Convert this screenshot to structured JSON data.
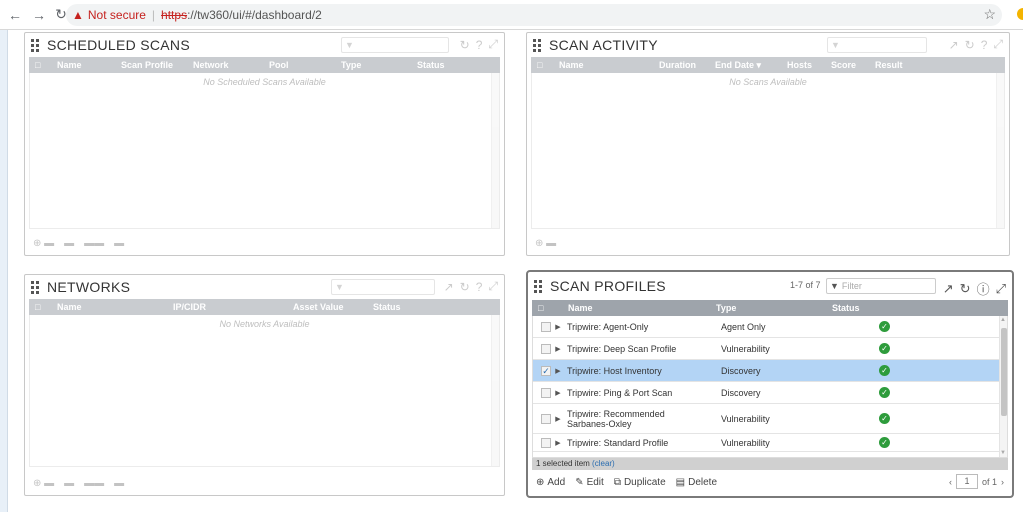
{
  "browser": {
    "not_secure": "Not secure",
    "url_https": "https",
    "url_rest": "://tw360/ui/#/dashboard/2"
  },
  "scheduled_scans": {
    "title": "SCHEDULED SCANS",
    "columns": [
      "Name",
      "Scan Profile",
      "Network",
      "Pool",
      "Type",
      "Status"
    ],
    "empty": "No Scheduled Scans Available"
  },
  "scan_activity": {
    "title": "SCAN ACTIVITY",
    "columns": [
      "Name",
      "Duration",
      "End Date ▾",
      "Hosts",
      "Score",
      "Result"
    ],
    "empty": "No Scans Available"
  },
  "networks": {
    "title": "NETWORKS",
    "columns": [
      "Name",
      "IP/CIDR",
      "Asset Value",
      "Status"
    ],
    "empty": "No Networks Available"
  },
  "scan_profiles": {
    "title": "SCAN PROFILES",
    "count": "1-7 of 7",
    "filter_placeholder": "Filter",
    "columns": [
      "Name",
      "Type",
      "Status"
    ],
    "rows": [
      {
        "name": "Tripwire: Agent-Only",
        "type": "Agent Only"
      },
      {
        "name": "Tripwire: Deep Scan Profile",
        "type": "Vulnerability"
      },
      {
        "name": "Tripwire: Host Inventory",
        "type": "Discovery"
      },
      {
        "name": "Tripwire: Ping & Port Scan",
        "type": "Discovery"
      },
      {
        "name": "Tripwire: Recommended Sarbanes-Oxley",
        "type": "Vulnerability"
      },
      {
        "name": "Tripwire: Standard Profile",
        "type": "Vulnerability"
      }
    ],
    "selected_text": "1 selected item",
    "clear_text": "(clear)",
    "add": "Add",
    "edit": "Edit",
    "duplicate": "Duplicate",
    "delete": "Delete",
    "page": "1",
    "of_pages": "of 1"
  },
  "colors": {
    "header_bg": "#9ea4ab",
    "selected_row": "#b3d4f5",
    "status_ok": "#2e9c3c",
    "link": "#2a6db0",
    "warning": "#c5221f"
  }
}
